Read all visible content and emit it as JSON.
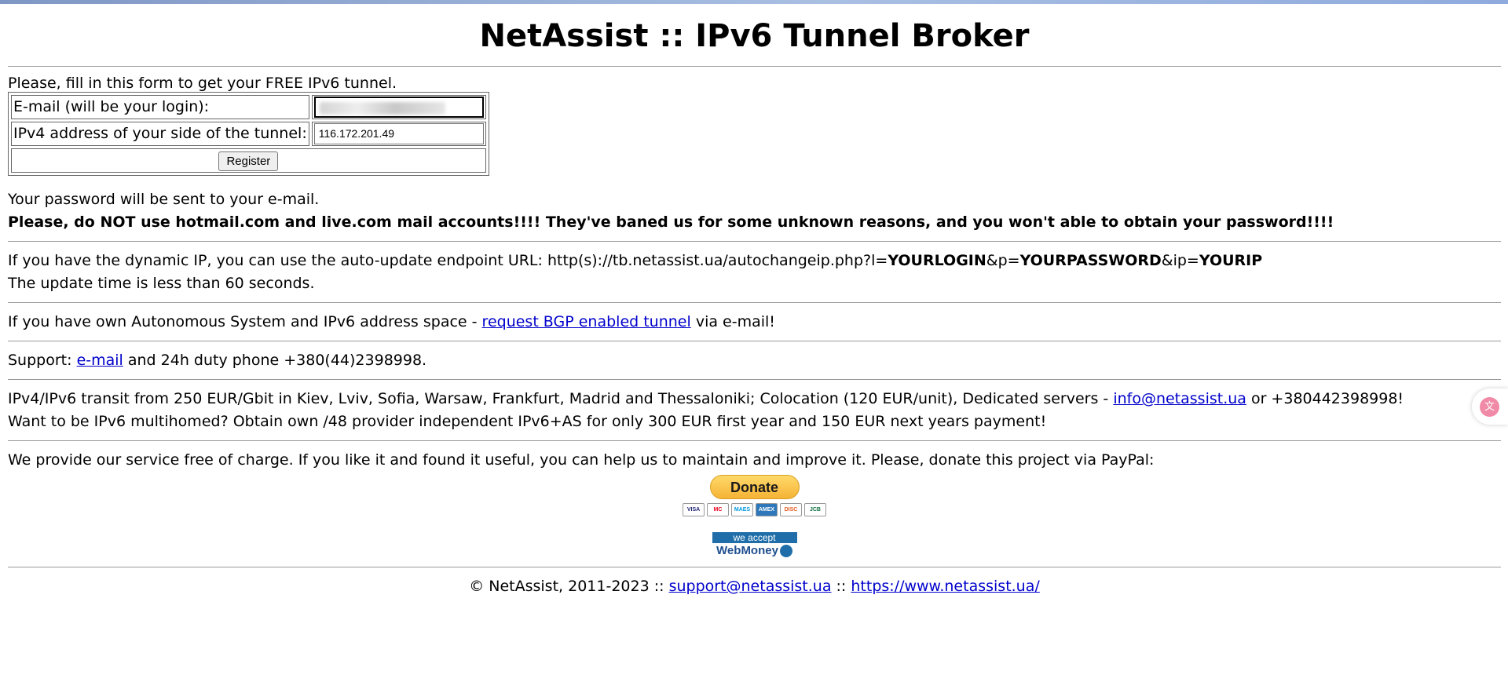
{
  "page": {
    "title": "NetAssist :: IPv6 Tunnel Broker"
  },
  "form": {
    "intro": "Please, fill in this form to get your FREE IPv6 tunnel.",
    "email_label": "E-mail (will be your login):",
    "email_value": "",
    "ipv4_label": "IPv4 address of your side of the tunnel:",
    "ipv4_value": "116.172.201.49",
    "register_label": "Register"
  },
  "password_notice": {
    "line1": "Your password will be sent to your e-mail.",
    "warning": "Please, do NOT use hotmail.com and live.com mail accounts!!!! They've baned us for some unknown reasons, and you won't able to obtain your password!!!!"
  },
  "dynamic_ip": {
    "prefix": "If you have the dynamic IP, you can use the auto-update endpoint URL: http(s)://tb.netassist.ua/autochangeip.php?l=",
    "login": "YOURLOGIN",
    "p_param": "&p=",
    "password": "YOURPASSWORD",
    "ip_param": "&ip=",
    "ip": "YOURIP",
    "update_time": "The update time is less than 60 seconds."
  },
  "bgp": {
    "prefix": "If you have own Autonomous System and IPv6 address space - ",
    "link": "request BGP enabled tunnel",
    "suffix": " via e-mail!"
  },
  "support": {
    "prefix": "Support: ",
    "link": "e-mail",
    "suffix": " and 24h duty phone +380(44)2398998."
  },
  "transit": {
    "line1_prefix": "IPv4/IPv6 transit from 250 EUR/Gbit in Kiev, Lviv, Sofia, Warsaw, Frankfurt, Madrid and Thessaloniki; Colocation (120 EUR/unit), Dedicated servers - ",
    "line1_link": "info@netassist.ua",
    "line1_suffix": " or +380442398998!",
    "line2": "Want to be IPv6 multihomed? Obtain own /48 provider independent IPv6+AS for only 300 EUR first year and 150 EUR next years payment!"
  },
  "donate": {
    "text": "We provide our service free of charge. If you like it and found it useful, you can help us to maintain and improve it. Please, donate this project via PayPal:",
    "button": "Donate",
    "cards": [
      "VISA",
      "MC",
      "MAES",
      "AMEX",
      "DISC",
      "JCB"
    ],
    "webmoney_top": "we accept",
    "webmoney_bottom": "WebMoney"
  },
  "footer": {
    "copyright": "© NetAssist, 2011-2023 :: ",
    "support_link": "support@netassist.ua",
    "separator": " :: ",
    "site_link": "https://www.netassist.ua/"
  },
  "colors": {
    "link": "#0000cc",
    "donate_button": "#f5b335",
    "webmoney": "#1f6ea9"
  },
  "icons": {
    "translate": "translate-icon",
    "webmoney_globe": "globe-icon"
  }
}
